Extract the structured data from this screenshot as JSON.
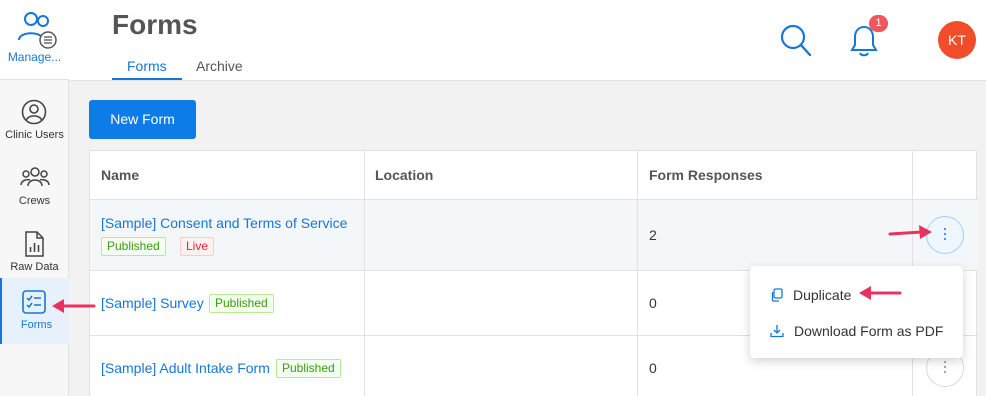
{
  "colors": {
    "primary": "#1677d8",
    "button": "#0e7ce8",
    "avatar": "#f14d2b",
    "badge": "#f0565e",
    "annotation_arrow": "#e8335f"
  },
  "sidebar": {
    "top": {
      "label": "Manage...",
      "icon": "users-list-icon"
    },
    "items": [
      {
        "label": "Clinic Users",
        "icon": "user-circle-icon",
        "active": false
      },
      {
        "label": "Crews",
        "icon": "users-group-icon",
        "active": false
      },
      {
        "label": "Raw Data",
        "icon": "chart-document-icon",
        "active": false
      },
      {
        "label": "Forms",
        "icon": "checklist-icon",
        "active": true
      }
    ]
  },
  "header": {
    "title": "Forms",
    "tabs": [
      {
        "label": "Forms",
        "active": true
      },
      {
        "label": "Archive",
        "active": false
      }
    ],
    "notifications_count": "1",
    "avatar_initials": "KT"
  },
  "toolbar": {
    "new_form_label": "New Form"
  },
  "table": {
    "columns": [
      "Name",
      "Location",
      "Form Responses",
      ""
    ],
    "rows": [
      {
        "name": "[Sample] Consent and Terms of Service",
        "tags": [
          "Published",
          "Live"
        ],
        "location": "",
        "responses": "2"
      },
      {
        "name": "[Sample] Survey",
        "tags": [
          "Published"
        ],
        "location": "",
        "responses": "0"
      },
      {
        "name": "[Sample] Adult Intake Form",
        "tags": [
          "Published"
        ],
        "location": "",
        "responses": "0"
      }
    ]
  },
  "row_menu": {
    "items": [
      {
        "label": "Duplicate",
        "icon": "copy-icon"
      },
      {
        "label": "Download Form as PDF",
        "icon": "download-icon"
      }
    ]
  }
}
